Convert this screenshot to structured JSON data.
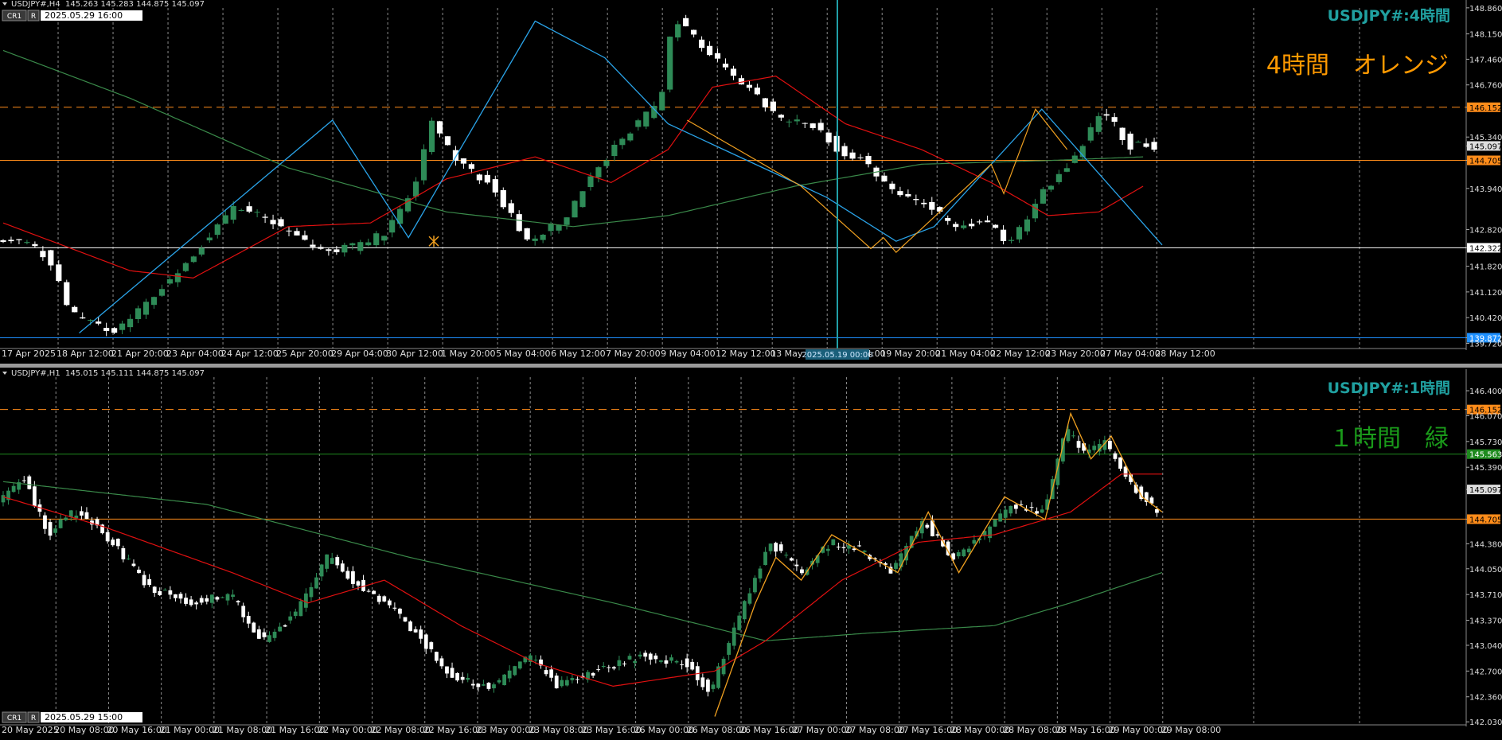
{
  "colors": {
    "background": "#000000",
    "candle_up": "#2e8b57",
    "candle_down": "#ffffff",
    "ma_fast": "#e01010",
    "ma_slow": "#3a8a4a",
    "zigzag_4h": "#2aa3e8",
    "zigzag_1h": "#f0a020",
    "level_orange": "#ff8c1a",
    "level_white": "#ffffff",
    "level_blue": "#1e90ff",
    "level_green": "#1e8a1e",
    "cursor_line": "#20a0a8",
    "title_teal": "#20a0a0",
    "label_orange": "#ff9900",
    "label_green": "#1a9a1a",
    "grid": "#bbbbbb",
    "pane_separator": "#9a9a9a"
  },
  "panes": [
    {
      "id": "h4",
      "header": {
        "symbol": "USDJPY#,H4",
        "ohlc": "145.263 145.283 144.875 145.097"
      },
      "buttons": {
        "cr": "CR1",
        "r": "R"
      },
      "datetime": "2025.05.29 16:00",
      "title": "USDJPY#:4時間",
      "label": "4時間　オレンジ",
      "cursor_time_label": "2025.05.19 00:00",
      "chart_data": {
        "type": "candlestick",
        "ylim": [
          139.6,
          148.9
        ],
        "price_ticks": [
          "148.860",
          "148.150",
          "147.460",
          "146.760",
          "146.152",
          "145.340",
          "145.097",
          "144.705",
          "143.940",
          "142.820",
          "142.322",
          "141.820",
          "141.120",
          "140.420",
          "139.872",
          "139.720"
        ],
        "price_tick_values": [
          148.86,
          148.15,
          147.46,
          146.76,
          146.152,
          145.34,
          145.097,
          144.705,
          143.94,
          142.82,
          142.322,
          141.82,
          141.12,
          140.42,
          139.872,
          139.72
        ],
        "price_tick_badges": {
          "146.152": "#ff8c1a",
          "145.097": "#dddddd",
          "144.705": "#ff8c1a",
          "142.322": "#ffffff",
          "139.872": "#1e90ff"
        },
        "time_labels": [
          "17 Apr 2025",
          "18 Apr 12:00",
          "21 Apr 20:00",
          "23 Apr 04:00",
          "24 Apr 12:00",
          "25 Apr 20:00",
          "29 Apr 04:00",
          "30 Apr 12:00",
          "1 May 20:00",
          "5 May 04:00",
          "6 May 12:00",
          "7 May 20:00",
          "9 May 04:00",
          "12 May 12:00",
          "13 May 20:00",
          "15 May 04:00",
          "19 May 20:00",
          "21 May 04:00",
          "22 May 12:00",
          "23 May 20:00",
          "27 May 04:00",
          "28 May 12:00"
        ],
        "bars": 146,
        "anchors": [
          [
            0,
            142.6
          ],
          [
            5,
            142.4
          ],
          [
            8,
            142.1
          ],
          [
            12,
            140.5
          ],
          [
            19,
            140.0
          ],
          [
            25,
            141.0
          ],
          [
            32,
            142.3
          ],
          [
            38,
            143.5
          ],
          [
            44,
            143.0
          ],
          [
            52,
            142.2
          ],
          [
            58,
            142.4
          ],
          [
            62,
            142.8
          ],
          [
            66,
            144.0
          ],
          [
            69,
            145.8
          ],
          [
            73,
            144.6
          ],
          [
            78,
            144.1
          ],
          [
            84,
            142.5
          ],
          [
            90,
            143.1
          ],
          [
            95,
            144.5
          ],
          [
            99,
            145.3
          ],
          [
            105,
            146.3
          ],
          [
            107,
            148.6
          ],
          [
            112,
            147.8
          ],
          [
            116,
            147.0
          ],
          [
            120,
            146.5
          ],
          [
            124,
            145.8
          ],
          [
            130,
            145.6
          ],
          [
            133,
            145.0
          ],
          [
            137,
            144.7
          ],
          [
            142,
            143.9
          ],
          [
            147,
            143.5
          ],
          [
            152,
            142.8
          ],
          [
            156,
            143.1
          ],
          [
            160,
            142.4
          ],
          [
            166,
            144.0
          ],
          [
            170,
            144.7
          ],
          [
            175,
            146.1
          ],
          [
            179,
            145.1
          ]
        ],
        "ma_fast": [
          [
            0,
            143.0
          ],
          [
            20,
            141.7
          ],
          [
            30,
            141.5
          ],
          [
            45,
            142.9
          ],
          [
            58,
            143.0
          ],
          [
            70,
            144.2
          ],
          [
            84,
            144.8
          ],
          [
            96,
            144.1
          ],
          [
            105,
            145.0
          ],
          [
            112,
            146.7
          ],
          [
            122,
            147.0
          ],
          [
            133,
            145.7
          ],
          [
            145,
            145.0
          ],
          [
            156,
            144.1
          ],
          [
            165,
            143.2
          ],
          [
            173,
            143.3
          ],
          [
            180,
            144.0
          ]
        ],
        "ma_slow": [
          [
            0,
            147.7
          ],
          [
            20,
            146.4
          ],
          [
            45,
            144.5
          ],
          [
            70,
            143.3
          ],
          [
            90,
            142.9
          ],
          [
            105,
            143.2
          ],
          [
            125,
            144.0
          ],
          [
            145,
            144.6
          ],
          [
            165,
            144.7
          ],
          [
            180,
            144.8
          ]
        ],
        "zigzag": [
          [
            12,
            140.0
          ],
          [
            52,
            145.8
          ],
          [
            64,
            142.6
          ],
          [
            84,
            148.5
          ],
          [
            95,
            147.5
          ],
          [
            105,
            145.7
          ],
          [
            130,
            143.7
          ],
          [
            141,
            142.5
          ],
          [
            147,
            142.9
          ],
          [
            164,
            146.1
          ],
          [
            183,
            142.4
          ]
        ],
        "zigzag_small": [
          [
            108,
            145.8
          ],
          [
            126,
            144.0
          ],
          [
            137,
            142.3
          ],
          [
            139,
            142.6
          ],
          [
            141,
            142.2
          ],
          [
            156,
            144.6
          ],
          [
            158,
            143.8
          ],
          [
            163,
            146.1
          ],
          [
            168,
            145.0
          ]
        ],
        "marker": {
          "bar": 68,
          "price": 142.5
        },
        "levels": [
          {
            "price": 146.152,
            "style": "dashed",
            "color": "#ff8c1a"
          },
          {
            "price": 144.705,
            "style": "solid",
            "color": "#ff8c1a"
          },
          {
            "price": 142.322,
            "style": "solid",
            "color": "#ffffff"
          },
          {
            "price": 139.872,
            "style": "solid",
            "color": "#1e90ff"
          }
        ]
      }
    },
    {
      "id": "h1",
      "header": {
        "symbol": "USDJPY#,H1",
        "ohlc": "145.015 145.111 144.875 145.097"
      },
      "buttons": {
        "cr": "CR1",
        "r": "R"
      },
      "datetime": "2025.05.29 15:00",
      "title": "USDJPY#:1時間",
      "label": "１時間　緑",
      "chart_data": {
        "type": "candlestick",
        "ylim": [
          142.0,
          146.6
        ],
        "price_ticks": [
          "146.400",
          "146.152",
          "146.070",
          "145.730",
          "145.563",
          "145.390",
          "145.097",
          "144.705",
          "144.380",
          "144.050",
          "143.710",
          "143.370",
          "143.040",
          "142.700",
          "142.360",
          "142.030"
        ],
        "price_tick_values": [
          146.4,
          146.152,
          146.07,
          145.73,
          145.563,
          145.39,
          145.097,
          144.705,
          144.38,
          144.05,
          143.71,
          143.37,
          143.04,
          142.7,
          142.36,
          142.03
        ],
        "price_tick_badges": {
          "146.152": "#ff8c1a",
          "145.563": "#1e8a1e",
          "145.097": "#dddddd",
          "144.705": "#ff8c1a"
        },
        "time_labels": [
          "20 May 2025",
          "20 May 08:00",
          "20 May 16:00",
          "21 May 00:00",
          "21 May 08:00",
          "21 May 16:00",
          "22 May 00:00",
          "22 May 08:00",
          "22 May 16:00",
          "23 May 00:00",
          "23 May 08:00",
          "23 May 16:00",
          "26 May 00:00",
          "26 May 08:00",
          "26 May 16:00",
          "27 May 00:00",
          "27 May 08:00",
          "27 May 16:00",
          "28 May 00:00",
          "28 May 08:00",
          "28 May 16:00",
          "29 May 00:00",
          "29 May 08:00"
        ],
        "bars": 222,
        "anchors": [
          [
            0,
            144.9
          ],
          [
            5,
            145.3
          ],
          [
            10,
            144.5
          ],
          [
            15,
            144.8
          ],
          [
            20,
            144.6
          ],
          [
            25,
            144.2
          ],
          [
            30,
            143.8
          ],
          [
            38,
            143.6
          ],
          [
            46,
            143.7
          ],
          [
            52,
            143.1
          ],
          [
            58,
            143.4
          ],
          [
            65,
            144.2
          ],
          [
            70,
            143.9
          ],
          [
            78,
            143.5
          ],
          [
            85,
            143.0
          ],
          [
            90,
            142.6
          ],
          [
            98,
            142.5
          ],
          [
            105,
            142.9
          ],
          [
            110,
            142.5
          ],
          [
            118,
            142.7
          ],
          [
            126,
            142.9
          ],
          [
            136,
            142.8
          ],
          [
            140,
            142.4
          ],
          [
            147,
            143.6
          ],
          [
            152,
            144.4
          ],
          [
            158,
            144.0
          ],
          [
            164,
            144.4
          ],
          [
            170,
            144.3
          ],
          [
            176,
            144.0
          ],
          [
            182,
            144.7
          ],
          [
            188,
            144.2
          ],
          [
            194,
            144.5
          ],
          [
            200,
            144.9
          ],
          [
            206,
            144.8
          ],
          [
            210,
            145.9
          ],
          [
            214,
            145.6
          ],
          [
            218,
            145.7
          ],
          [
            224,
            145.1
          ],
          [
            228,
            144.8
          ]
        ],
        "ma_fast": [
          [
            0,
            145.0
          ],
          [
            20,
            144.6
          ],
          [
            45,
            144.0
          ],
          [
            60,
            143.6
          ],
          [
            75,
            143.9
          ],
          [
            90,
            143.3
          ],
          [
            105,
            142.8
          ],
          [
            120,
            142.5
          ],
          [
            140,
            142.7
          ],
          [
            150,
            143.1
          ],
          [
            165,
            143.9
          ],
          [
            180,
            144.4
          ],
          [
            195,
            144.5
          ],
          [
            210,
            144.8
          ],
          [
            220,
            145.3
          ],
          [
            228,
            145.3
          ]
        ],
        "ma_slow": [
          [
            0,
            145.2
          ],
          [
            40,
            144.9
          ],
          [
            80,
            144.2
          ],
          [
            120,
            143.6
          ],
          [
            150,
            143.1
          ],
          [
            170,
            143.2
          ],
          [
            195,
            143.3
          ],
          [
            210,
            143.6
          ],
          [
            228,
            144.0
          ]
        ],
        "zigzag": [
          [
            140,
            142.1
          ],
          [
            148,
            143.6
          ],
          [
            152,
            144.2
          ],
          [
            157,
            143.9
          ],
          [
            163,
            144.5
          ],
          [
            176,
            144.0
          ],
          [
            182,
            144.8
          ],
          [
            188,
            144.0
          ],
          [
            197,
            145.0
          ],
          [
            205,
            144.7
          ],
          [
            210,
            146.1
          ],
          [
            214,
            145.5
          ],
          [
            218,
            145.8
          ],
          [
            224,
            145.0
          ],
          [
            228,
            144.8
          ]
        ],
        "levels": [
          {
            "price": 146.152,
            "style": "dashed",
            "color": "#ff8c1a"
          },
          {
            "price": 145.563,
            "style": "solid",
            "color": "#1e8a1e"
          },
          {
            "price": 144.705,
            "style": "solid",
            "color": "#ff8c1a"
          }
        ]
      }
    }
  ]
}
